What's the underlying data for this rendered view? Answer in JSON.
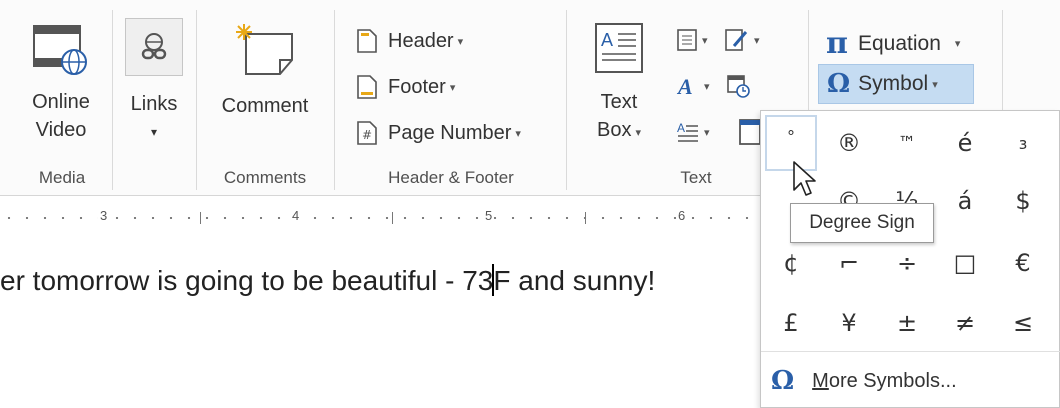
{
  "ribbon": {
    "media": {
      "online_video_line1": "Online",
      "online_video_line2": "Video",
      "group_label": "Media"
    },
    "links": {
      "label": "Links",
      "caret": "▾"
    },
    "comments": {
      "comment_label": "Comment",
      "group_label": "Comments"
    },
    "header_footer": {
      "header_label": "Header",
      "footer_label": "Footer",
      "page_number_label": "Page Number",
      "group_label": "Header & Footer"
    },
    "text": {
      "textbox_line1": "Text",
      "textbox_line2": "Box",
      "group_label": "Text"
    },
    "symbols": {
      "equation_label": "Equation",
      "symbol_label": "Symbol"
    },
    "caret": "▾"
  },
  "ruler": {
    "marks": [
      "3",
      "4",
      "5",
      "6"
    ]
  },
  "document": {
    "text_before_cursor": "er tomorrow is going to be beautiful - 73",
    "text_after_cursor": "F and sunny!"
  },
  "symbol_menu": {
    "rows": [
      [
        "°",
        "®",
        "™",
        "é",
        "з"
      ],
      [
        "",
        "©",
        "½",
        "á",
        "$"
      ],
      [
        "¢",
        "⌐",
        "÷",
        "□",
        "€"
      ],
      [
        "£",
        "¥",
        "±",
        "≠",
        "≤"
      ]
    ],
    "selected": "°",
    "tooltip": "Degree Sign",
    "more_symbols_label": "More Symbols...",
    "more_symbols_underline": "M",
    "more_symbols_rest": "ore Symbols..."
  },
  "colors": {
    "accent_blue": "#2a5fa8",
    "selected_bg": "#c5dcf2"
  }
}
